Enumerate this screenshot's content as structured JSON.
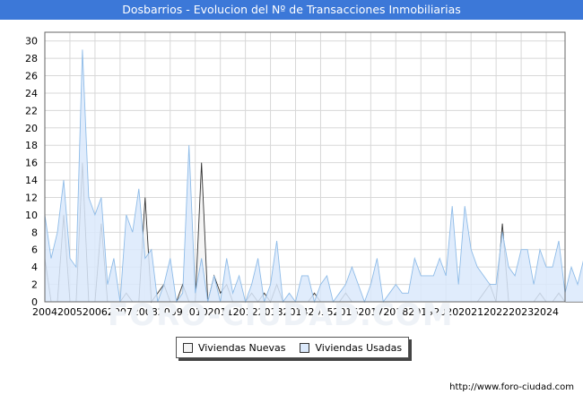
{
  "page": {
    "title": "Dosbarrios - Evolucion del Nº de Transacciones Inmobiliarias",
    "source_url": "http://www.foro-ciudad.com",
    "watermark": "FORO-CIUDAD.COM"
  },
  "colors": {
    "title_bg": "#3c78d8",
    "nuevas_fill": "#f4f4f4",
    "nuevas_line": "#333333",
    "usadas_fill": "#dbe9fb",
    "usadas_line": "#8fbce8",
    "grid": "#d8d8d8"
  },
  "chart_data": {
    "type": "area",
    "title": "Dosbarrios - Evolucion del Nº de Transacciones Inmobiliarias",
    "xlabel": "",
    "ylabel": "",
    "x_start": 2004,
    "x_end": 2024.75,
    "period": "quarter",
    "ylim": [
      0,
      31
    ],
    "yticks": [
      0,
      2,
      4,
      6,
      8,
      10,
      12,
      14,
      16,
      18,
      20,
      22,
      24,
      26,
      28,
      30
    ],
    "xticks": [
      "2004",
      "2005",
      "2006",
      "2007",
      "2008",
      "2009",
      "2010",
      "2011",
      "2012",
      "2013",
      "2014",
      "2015",
      "2016",
      "2017",
      "2018",
      "2019",
      "2020",
      "2021",
      "2022",
      "2023",
      "2024"
    ],
    "grid": true,
    "legend_position": "bottom",
    "series": [
      {
        "name": "Viviendas Nuevas",
        "values": [
          5,
          0,
          0,
          10,
          0,
          0,
          16,
          0,
          0,
          9,
          0,
          0,
          0,
          1,
          0,
          0,
          12,
          0,
          1,
          2,
          0,
          0,
          2,
          0,
          0,
          16,
          0,
          3,
          1,
          2,
          0,
          0,
          0,
          1,
          0,
          1,
          0,
          2,
          0,
          0,
          0,
          0,
          0,
          1,
          0,
          0,
          0,
          0,
          1,
          0,
          0,
          0,
          0,
          0,
          0,
          0,
          0,
          0,
          0,
          0,
          0,
          0,
          0,
          0,
          0,
          0,
          0,
          0,
          0,
          0,
          1,
          2,
          0,
          9,
          0,
          0,
          0,
          0,
          0,
          1,
          0,
          0,
          1,
          0,
          0,
          0,
          0,
          0,
          0,
          0,
          0,
          0,
          0,
          0,
          0,
          0,
          0,
          0,
          1,
          1,
          0,
          0,
          0
        ]
      },
      {
        "name": "Viviendas Usadas",
        "values": [
          10,
          5,
          8,
          14,
          5,
          4,
          29,
          12,
          10,
          12,
          2,
          5,
          0,
          10,
          8,
          13,
          5,
          6,
          0,
          2,
          5,
          0,
          1,
          18,
          1,
          5,
          0,
          3,
          0,
          5,
          1,
          3,
          0,
          2,
          5,
          0,
          2,
          7,
          0,
          1,
          0,
          3,
          3,
          0,
          2,
          3,
          0,
          1,
          2,
          4,
          2,
          0,
          2,
          5,
          0,
          1,
          2,
          1,
          1,
          5,
          3,
          3,
          3,
          5,
          3,
          11,
          2,
          11,
          6,
          4,
          3,
          2,
          2,
          8,
          4,
          3,
          6,
          6,
          2,
          6,
          4,
          4,
          7,
          1,
          4,
          2,
          5,
          11,
          6
        ]
      }
    ]
  },
  "legend": {
    "nuevas_label": "Viviendas Nuevas",
    "usadas_label": "Viviendas Usadas"
  }
}
